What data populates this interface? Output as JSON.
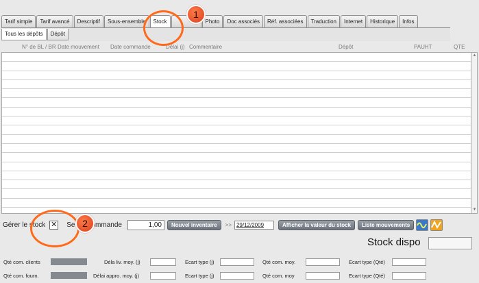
{
  "tabs": [
    "Tarif simple",
    "Tarif avancé",
    "Descriptif",
    "Sous-ensemble",
    "Stock",
    "",
    "Photo",
    "Doc associés",
    "Réf. associées",
    "Traduction",
    "Internet",
    "Historique",
    "Infos"
  ],
  "subtabs": [
    "Tous les dépôts",
    "Dépôt"
  ],
  "columns": [
    "N° de BL / BR",
    "Date mouvement",
    "Date commande",
    "Délai (j)",
    "Commentaire",
    "Dépôt",
    "PAUHT",
    "QTE"
  ],
  "controls": {
    "gerer_label": "Gérer le stock",
    "checkbox_mark": "✕",
    "seuil_label": "Se",
    "commande_label": "ommande",
    "quantity_value": "1,00",
    "nouvel_inventaire": "Nouvel inventaire",
    "date_sep": ">>",
    "date_value": "29/12/2009",
    "afficher_valeur": "Afficher la valeur du stock",
    "liste_mouvements": "Liste mouvements"
  },
  "stock_dispo_label": "Stock dispo",
  "stats": {
    "row1": {
      "qte_label": "Qté com. clients",
      "delai_label": "Déla liv. moy. (j)",
      "ecart_label": "Ecart type (j)",
      "qte_moy_label": "Qté com. moy.",
      "ecart_qte_label": "Ecart type (Qté)"
    },
    "row2": {
      "qte_label": "Qté com. fourn.",
      "delai_label": "Délai appro. moy. (j)",
      "ecart_label": "Ecart type (j)",
      "qte_moy_label": "Qté com. moy",
      "ecart_qte_label": "Ecart type (Qté)"
    }
  },
  "annotations": {
    "marker1": "1",
    "marker2": "2"
  },
  "colors": {
    "accent": "#ff6a1a",
    "button": "#7a8088"
  }
}
